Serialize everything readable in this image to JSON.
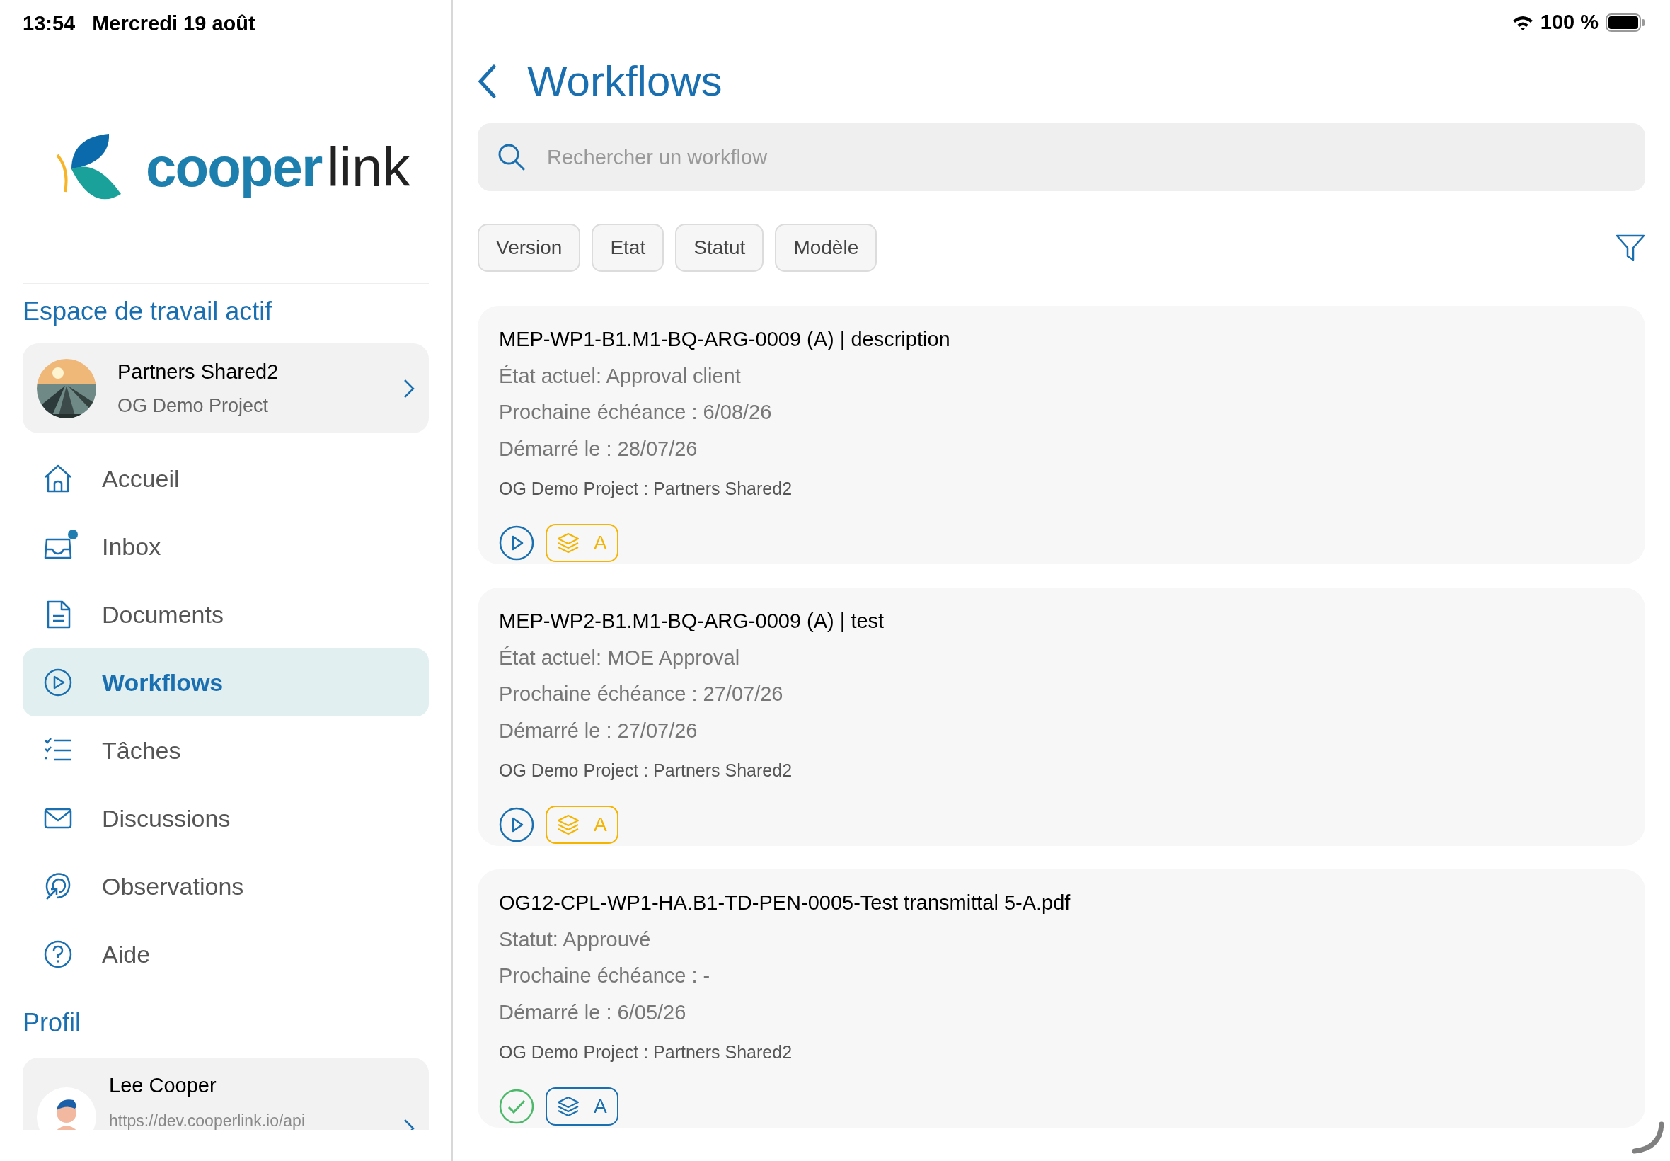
{
  "status_bar": {
    "time": "13:54",
    "date": "Mercredi 19 août",
    "battery_text": "100 %"
  },
  "sidebar": {
    "logo": {
      "part_1": "cooper",
      "part_2": "link"
    },
    "workspace_heading": "Espace de travail actif",
    "workspace": {
      "name": "Partners Shared2",
      "project": "OG Demo Project"
    },
    "items": [
      {
        "label": "Accueil",
        "selected": false,
        "badge": false
      },
      {
        "label": "Inbox",
        "selected": false,
        "badge": true
      },
      {
        "label": "Documents",
        "selected": false,
        "badge": false
      },
      {
        "label": "Workflows",
        "selected": true,
        "badge": false
      },
      {
        "label": "Tâches",
        "selected": false,
        "badge": false
      },
      {
        "label": "Discussions",
        "selected": false,
        "badge": false
      },
      {
        "label": "Observations",
        "selected": false,
        "badge": false
      },
      {
        "label": "Aide",
        "selected": false,
        "badge": false
      }
    ],
    "profile_heading": "Profil",
    "profile": {
      "name": "Lee Cooper",
      "url": "https://dev.cooperlink.io/api"
    }
  },
  "main": {
    "title": "Workflows",
    "search": {
      "placeholder": "Rechercher un workflow"
    },
    "filters": [
      "Version",
      "Etat",
      "Statut",
      "Modèle"
    ],
    "cards": [
      {
        "title": "MEP-WP1-B1.M1-BQ-ARG-0009 (A) | description",
        "lines": [
          "État actuel: Approval client",
          "Prochaine échéance : 6/08/26",
          "Démarré le : 28/07/26"
        ],
        "project": "OG Demo Project : Partners Shared2",
        "kind": "running",
        "version": {
          "label": "A",
          "color": "#f5b400"
        }
      },
      {
        "title": "MEP-WP2-B1.M1-BQ-ARG-0009 (A) | test",
        "lines": [
          "État actuel: MOE Approval",
          "Prochaine échéance : 27/07/26",
          "Démarré le : 27/07/26"
        ],
        "project": "OG Demo Project : Partners Shared2",
        "kind": "running",
        "version": {
          "label": "A",
          "color": "#f5b400"
        }
      },
      {
        "title": "OG12-CPL-WP1-HA.B1-TD-PEN-0005-Test transmittal 5-A.pdf",
        "lines": [
          "Statut: Approuvé",
          "Prochaine échéance : -",
          "Démarré le : 6/05/26"
        ],
        "project": "OG Demo Project : Partners Shared2",
        "kind": "approved",
        "version": {
          "label": "A",
          "color": "#1a6fb0"
        }
      }
    ]
  }
}
